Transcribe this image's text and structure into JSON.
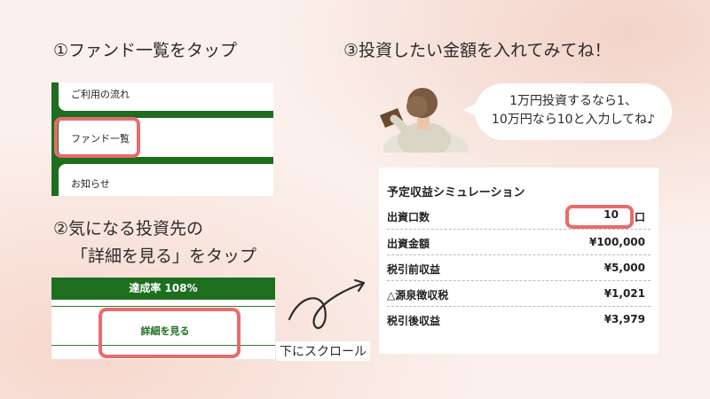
{
  "steps": {
    "step1_title": "①ファンド一覧をタップ",
    "step2_title_line1": "②気になる投資先の",
    "step2_title_line2": "「詳細を見る」をタップ",
    "step3_title": "③投資したい金額を入れてみてね！"
  },
  "menu": {
    "items": [
      {
        "label": "ご利用の流れ"
      },
      {
        "label": "ファンド一覧"
      },
      {
        "label": "お知らせ"
      }
    ]
  },
  "detail_panel": {
    "achievement": "達成率 108%",
    "detail_button": "詳細を見る"
  },
  "scroll_hint": "下にスクロール",
  "bubble": {
    "line1": "1万円投資するなら1、",
    "line2": "10万円なら10と入力してね♪"
  },
  "simulation": {
    "title": "予定収益シミュレーション",
    "rows": [
      {
        "label": "出資口数",
        "value": "10",
        "suffix": "口"
      },
      {
        "label": "出資金額",
        "value": "¥100,000"
      },
      {
        "label": "税引前収益",
        "value": "¥5,000"
      },
      {
        "label": "△源泉徴収税",
        "value": "¥1,021"
      },
      {
        "label": "税引後収益",
        "value": "¥3,979"
      }
    ]
  },
  "colors": {
    "brand_green": "#1d6e1f",
    "highlight": "#ea6b6b"
  }
}
